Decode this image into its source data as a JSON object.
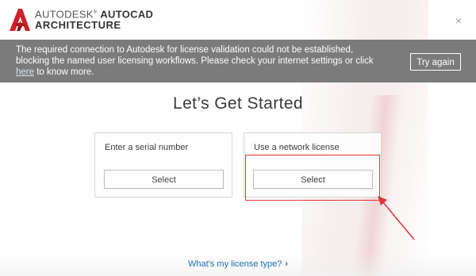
{
  "header": {
    "brand_line1_a": "AUTODESK",
    "brand_line1_b": "AUTOCAD",
    "brand_line2": "ARCHITECTURE",
    "close_glyph": "×"
  },
  "banner": {
    "message_part1": "The required connection to Autodesk for license validation could not be established, blocking the named user licensing workflows. Please check your internet settings or click",
    "link_text": "here",
    "message_part2": "to know more.",
    "retry_label": "Try again"
  },
  "main": {
    "title": "Let’s Get Started",
    "cards": [
      {
        "label": "Enter a serial number",
        "button_label": "Select"
      },
      {
        "label": "Use a network license",
        "button_label": "Select"
      }
    ],
    "footer_link": "What’s my license type?",
    "footer_chevron": "›"
  },
  "colors": {
    "banner_bg": "#7b7b7b",
    "logo_red": "#d0202a",
    "annotation_red": "#e53238",
    "link_blue": "#1b6fb0"
  },
  "icons": [
    "autocad-logo-icon",
    "close-icon",
    "chevron-right-icon"
  ]
}
